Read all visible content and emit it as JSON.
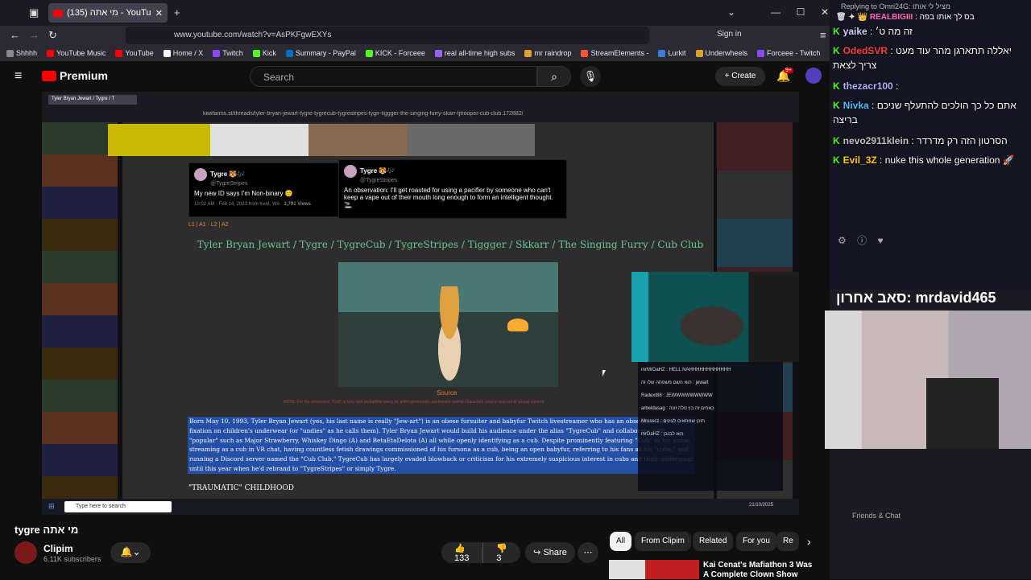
{
  "browser": {
    "tab_title": "(135) מי אתה - YouTube",
    "url": "www.youtube.com/watch?v=AsPKFgwEXYs",
    "signin": "Sign in",
    "bookmarks": [
      "Shhhh",
      "YouTube Music",
      "YouTube",
      "Home / X",
      "Twitch",
      "Kick",
      "Summary - PayPal",
      "KICK - Forceee",
      "real all-time high subs",
      "mr raindrop",
      "StreamElements -",
      "Lurkit",
      "Underwheels",
      "Forceee - Twitch"
    ],
    "bookmark_colors": [
      "#888888",
      "#ff0000",
      "#ff0000",
      "#ffffff",
      "#9146ff",
      "#53fc18",
      "#0070ba",
      "#53fc18",
      "#a060ff",
      "#e0a030",
      "#ff5533",
      "#3a7ad8",
      "#e0a030",
      "#9146ff"
    ]
  },
  "youtube": {
    "logo_text": "Premium",
    "search_placeholder": "Search",
    "create_label": "Create",
    "notif_count": "9+"
  },
  "video": {
    "inner_tab": "Tyler Bryan Jewart / Tygre / T",
    "inner_url": "kiwifarms.st/threads/tyler-bryan-jewart-tygre-tygrecub-tygrestripes-tygir-tiggger-the-singing-furry-skarr-tjtrooper-cub-club.172882/",
    "tweet1": {
      "name": "Tygre 🐯🎶",
      "handle": "@TygreStripes",
      "text": "My new ID says I'm Non-binary 😊",
      "meta": "10:02 AM · Feb 14, 2023 from Kent, WA ·",
      "views": "3,791 Views"
    },
    "tweet2": {
      "name": "Tygre 🐯🎶",
      "handle": "@TygreStripes",
      "text": "An observation: I'll get roasted for using a pacifier by someone who can't keep a vape out of their mouth long enough to form an intelligent thought. 🚬"
    },
    "page_links": "L1 | A1 · L2 | A2",
    "thread_title": "Tyler Bryan Jewart / Tygre / TygreCub / TygreStripes / Tiggger / Skkarr / The Singing Furry / Cub Club",
    "source": "Source",
    "note": "NOTE: For the uninitiated, \"Cub\" is furry and pedophilia slang for anthropomorphic adolescent animal characters used in and out of sexual content.",
    "bio": "Born May 10, 1993, Tyler Bryan Jewart (yes, his last name is really \"Jew-art\") is an obese fursuiter and babyfur Twitch livestreamer who has an obsessive sexual fixation on children's underwear (or \"undies\" as he calls them). Tyler Bryan Jewart would build his audience under the alias \"TygreCub\" and collaborate with \"popular\" such as Major Strawberry, Whiskey Dingo (A) and BetaEtaDelota (A) all while openly identifying as a cub. Despite prominently featuring \"Cub\" in his name, streaming as a cub in VR chat, having countless fetish drawings commissioned of his fursona as a cub, being an open babyfur, referring to his fans as his \"cubs,\" and running a Discord server named the \"Cub Club,\" TygreCub has largely evaded blowback or criticism for his extremely suspicious interest in cubs and their underwear until this year when he'd rebrand to \"TygreStripes\" or simply Tygre.",
    "section_heading": "\"TRAUMATIC\" CHILDHOOD",
    "stream_chat": [
      "mrMrDaHZ : HELL NAHHHHHHHHHHHH",
      "הוא השם משפחה שלו זה : jewart",
      "Radext88 : JEWWWWWWWWW",
      "arbeldasag : כאחים זה בין טלה זונה",
      "Mrusscz : תוכן שמתאים לעינים",
      "mrDaHZ : הוא לבנבן"
    ],
    "inner_search": "Type here to search",
    "inner_clock": "21/10/2025"
  },
  "below": {
    "title": "tygre מי אתה",
    "channel": "Clipim",
    "subscribers": "6.11K subscribers",
    "likes": "133",
    "dislikes": "3",
    "share": "Share",
    "chips": [
      "All",
      "From Clipim",
      "Related",
      "For you",
      "Re"
    ],
    "suggestion_title": "Kai Cenat's Mafiathon 3 Was A Complete Clown Show"
  },
  "overlay_chat": {
    "replying": "Replying to Omri24G: מציל לי אותו",
    "top_user": "REALBIGIII",
    "top_message": "בס לך אותו בפה",
    "lines": [
      {
        "user": "yaike",
        "msg": "זה מה ט׳",
        "color": "#d0d0ff"
      },
      {
        "user": "OdedSVR",
        "msg": "יאללה תתארגן מהר עוד מעט צריך לצאת",
        "color": "#ff4040"
      },
      {
        "user": "thezacr100",
        "msg": "",
        "color": "#b0b0ff"
      },
      {
        "user": "Nivka",
        "msg": "אתם כל כך הולכים להתעלף שניכם בריצה",
        "color": "#40c0ff"
      },
      {
        "user": "nevo2911klein",
        "msg": "הסרטון הזה רק מדרדר",
        "color": "#c0c0c0"
      },
      {
        "user": "Evil_3Z",
        "msg": "nuke this whole generation 🚀",
        "color": "#ffcc00"
      }
    ],
    "streamer_banner": "סאב אחרון: mrdavid465",
    "friends": "Friends & Chat"
  }
}
